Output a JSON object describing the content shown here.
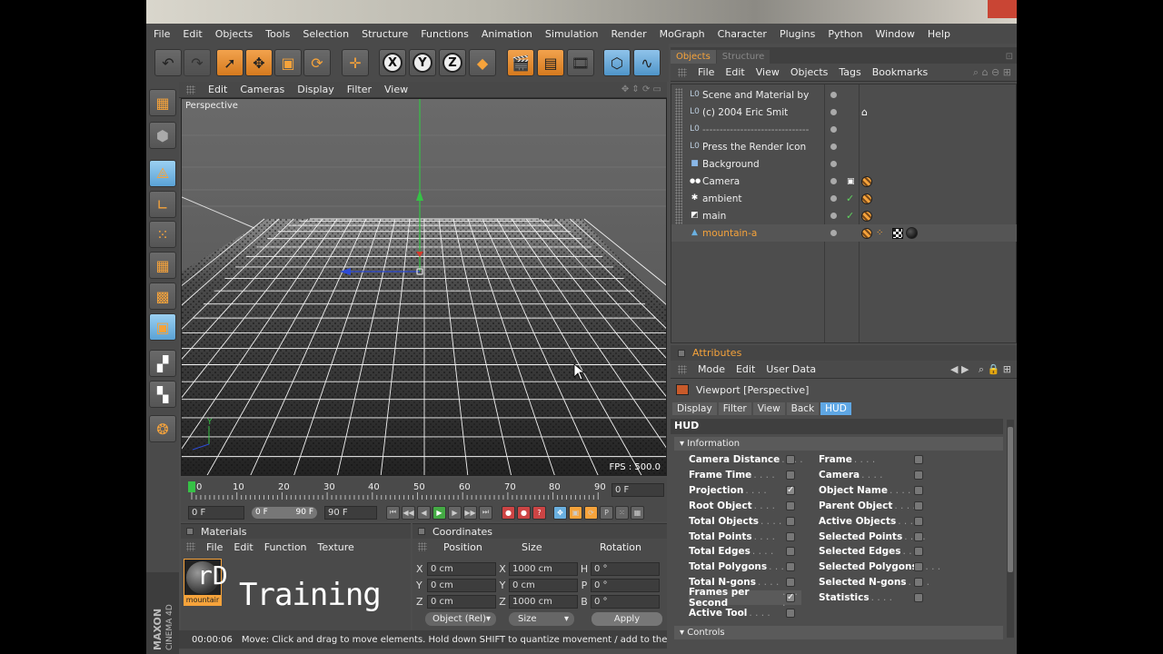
{
  "menubar": [
    "File",
    "Edit",
    "Objects",
    "Tools",
    "Selection",
    "Structure",
    "Functions",
    "Animation",
    "Simulation",
    "Render",
    "MoGraph",
    "Character",
    "Plugins",
    "Python",
    "Window",
    "Help"
  ],
  "viewport": {
    "menu": [
      "Edit",
      "Cameras",
      "Display",
      "Filter",
      "View"
    ],
    "label": "Perspective",
    "fps": "FPS : 500.0"
  },
  "toolbar": {
    "axis_x": "X",
    "axis_y": "Y",
    "axis_z": "Z"
  },
  "timeline": {
    "ticks": [
      "0",
      "10",
      "20",
      "30",
      "40",
      "50",
      "60",
      "70",
      "80",
      "90"
    ],
    "current_frame": "0 F"
  },
  "controls": {
    "start": "0 F",
    "range_start": "0 F",
    "range_end": "90 F",
    "end": "90 F"
  },
  "materials": {
    "title": "Materials",
    "menu": [
      "File",
      "Edit",
      "Function",
      "Texture"
    ],
    "thumb_label": "mountair",
    "thumb_big": "rD"
  },
  "brand": {
    "training": "Training",
    "maxon": "MAXON",
    "cinema": "CINEMA 4D"
  },
  "coordinates": {
    "title": "Coordinates",
    "headers": [
      "Position",
      "Size",
      "Rotation"
    ],
    "rows": [
      {
        "a": "X",
        "p": "0 cm",
        "b": "X",
        "s": "1000 cm",
        "c": "H",
        "r": "0 °"
      },
      {
        "a": "Y",
        "p": "0 cm",
        "b": "Y",
        "s": "0 cm",
        "c": "P",
        "r": "0 °"
      },
      {
        "a": "Z",
        "p": "0 cm",
        "b": "Z",
        "s": "1000 cm",
        "c": "B",
        "r": "0 °"
      }
    ],
    "mode": "Object (Rel)",
    "size_mode": "Size",
    "apply": "Apply"
  },
  "status": {
    "time": "00:00:06",
    "message": "Move: Click and drag to move elements. Hold down SHIFT to quantize movement / add to the selection i"
  },
  "objects": {
    "tabs": [
      "Objects",
      "Structure"
    ],
    "menu": [
      "File",
      "Edit",
      "View",
      "Objects",
      "Tags",
      "Bookmarks"
    ],
    "items": [
      {
        "name": "Scene and Material by",
        "icon": "L0"
      },
      {
        "name": "(c) 2004 Eric Smit",
        "icon": "L0"
      },
      {
        "name": "-------------------------------",
        "icon": "L0"
      },
      {
        "name": "Press the Render Icon",
        "icon": "L0"
      },
      {
        "name": "Background",
        "icon": "■"
      },
      {
        "name": "Camera",
        "icon": "●●"
      },
      {
        "name": "ambient",
        "icon": "✱"
      },
      {
        "name": "main",
        "icon": "◩"
      },
      {
        "name": "mountain-a",
        "icon": "▲"
      }
    ]
  },
  "attributes": {
    "title": "Attributes",
    "menu": [
      "Mode",
      "Edit",
      "User Data"
    ],
    "object": "Viewport [Perspective]",
    "tabs": [
      "Display",
      "Filter",
      "View",
      "Back",
      "HUD"
    ],
    "active_tab": "HUD",
    "group": "HUD",
    "section_information": "Information",
    "section_controls": "Controls",
    "left_items": [
      {
        "label": "Camera Distance",
        "checked": false
      },
      {
        "label": "Frame Time",
        "checked": false
      },
      {
        "label": "Projection",
        "checked": true
      },
      {
        "label": "Root Object",
        "checked": false
      },
      {
        "label": "Total Objects",
        "checked": false
      },
      {
        "label": "Total Points",
        "checked": false
      },
      {
        "label": "Total Edges",
        "checked": false
      },
      {
        "label": "Total Polygons",
        "checked": false
      },
      {
        "label": "Total N-gons",
        "checked": false
      },
      {
        "label": "Frames per Second",
        "checked": true
      },
      {
        "label": "Active Tool",
        "checked": false
      }
    ],
    "right_items": [
      {
        "label": "Frame",
        "checked": false
      },
      {
        "label": "Camera",
        "checked": false
      },
      {
        "label": "Object Name",
        "checked": false
      },
      {
        "label": "Parent Object",
        "checked": false
      },
      {
        "label": "Active Objects",
        "checked": false
      },
      {
        "label": "Selected Points",
        "checked": false
      },
      {
        "label": "Selected Edges",
        "checked": false
      },
      {
        "label": "Selected Polygons",
        "checked": false
      },
      {
        "label": "Selected N-gons",
        "checked": false
      },
      {
        "label": "Statistics",
        "checked": false
      }
    ]
  }
}
